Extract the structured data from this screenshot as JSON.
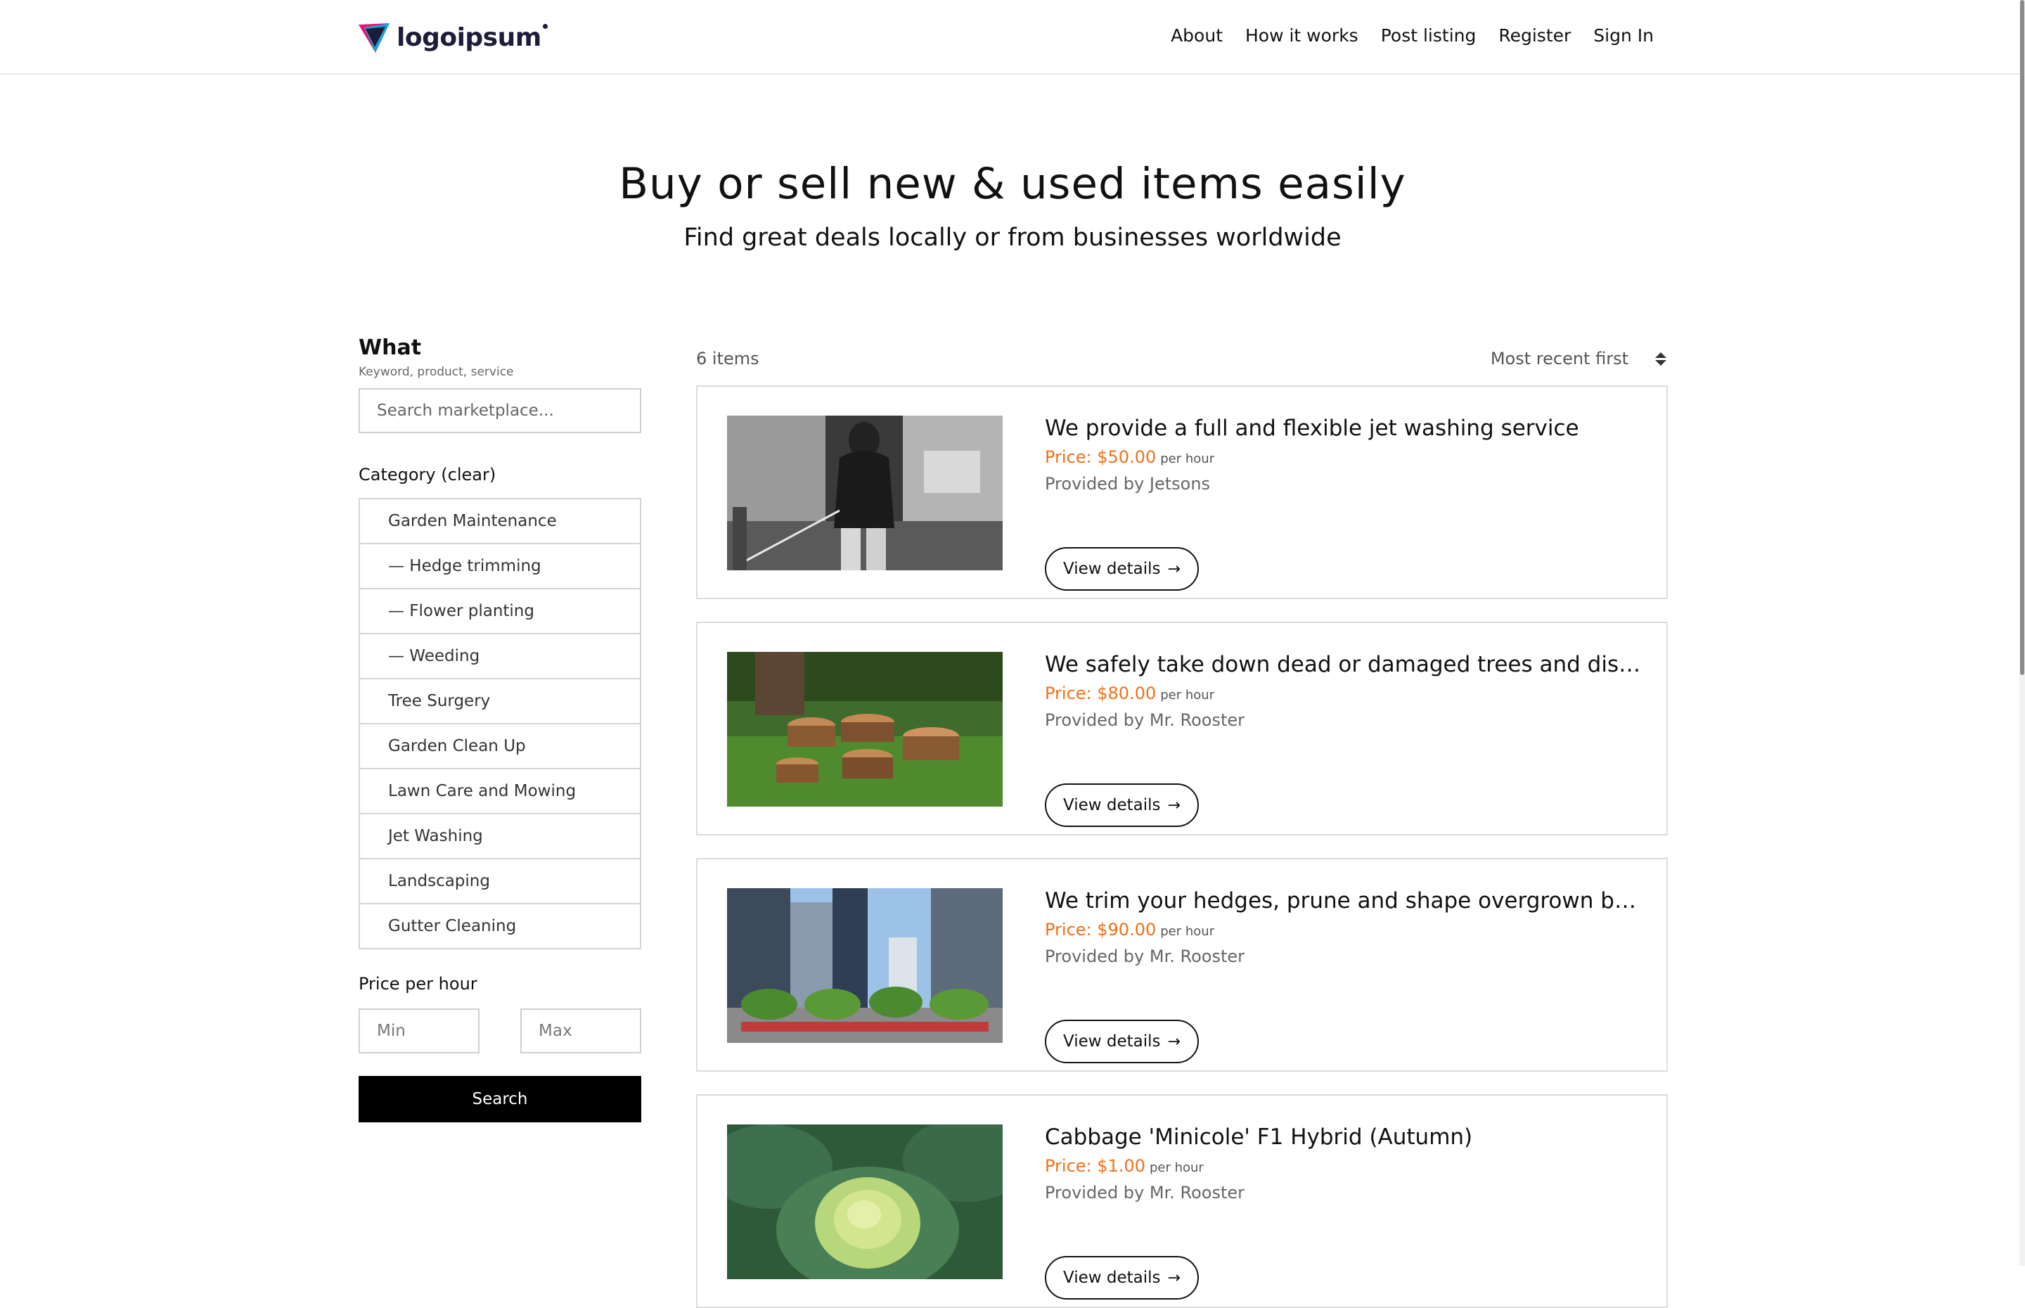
{
  "header": {
    "logo_text": "logoipsum",
    "nav": [
      "About",
      "How it works",
      "Post listing",
      "Register",
      "Sign In"
    ]
  },
  "hero": {
    "title": "Buy or sell new & used items easily",
    "subtitle": "Find great deals locally or from businesses worldwide"
  },
  "filters": {
    "what_title": "What",
    "what_hint": "Keyword, product, service",
    "search_placeholder": "Search marketplace...",
    "category_title": "Category (clear)",
    "categories": [
      "Garden Maintenance",
      "— Hedge trimming",
      "— Flower planting",
      "— Weeding",
      "Tree Surgery",
      "Garden Clean Up",
      "Lawn Care and Mowing",
      "Jet Washing",
      "Landscaping",
      "Gutter Cleaning"
    ],
    "price_title": "Price per hour",
    "min_placeholder": "Min",
    "max_placeholder": "Max",
    "search_button": "Search"
  },
  "results": {
    "count": "6 items",
    "sort_label": "Most recent first",
    "listings": [
      {
        "title": "We provide a full and flexible jet washing service",
        "price": "Price: $50.00",
        "unit": "per hour",
        "provider": "Provided by Jetsons",
        "button": "View details"
      },
      {
        "title": "We safely take down dead or damaged trees and dispose of them",
        "price": "Price: $80.00",
        "unit": "per hour",
        "provider": "Provided by Mr. Rooster",
        "button": "View details"
      },
      {
        "title": "We trim your hedges, prune and shape overgrown branches",
        "price": "Price: $90.00",
        "unit": "per hour",
        "provider": "Provided by Mr. Rooster",
        "button": "View details"
      },
      {
        "title": "Cabbage 'Minicole' F1 Hybrid (Autumn)",
        "price": "Price: $1.00",
        "unit": "per hour",
        "provider": "Provided by Mr. Rooster",
        "button": "View details"
      }
    ]
  },
  "colors": {
    "accent_price": "#f07018",
    "logo_pink": "#e6156f",
    "logo_navy": "#1b1d3a",
    "logo_blue": "#1aa3d6",
    "button_primary": "#000000"
  },
  "icons": [
    "logo-mark-icon",
    "sort-arrows-icon",
    "arrow-right-icon"
  ]
}
